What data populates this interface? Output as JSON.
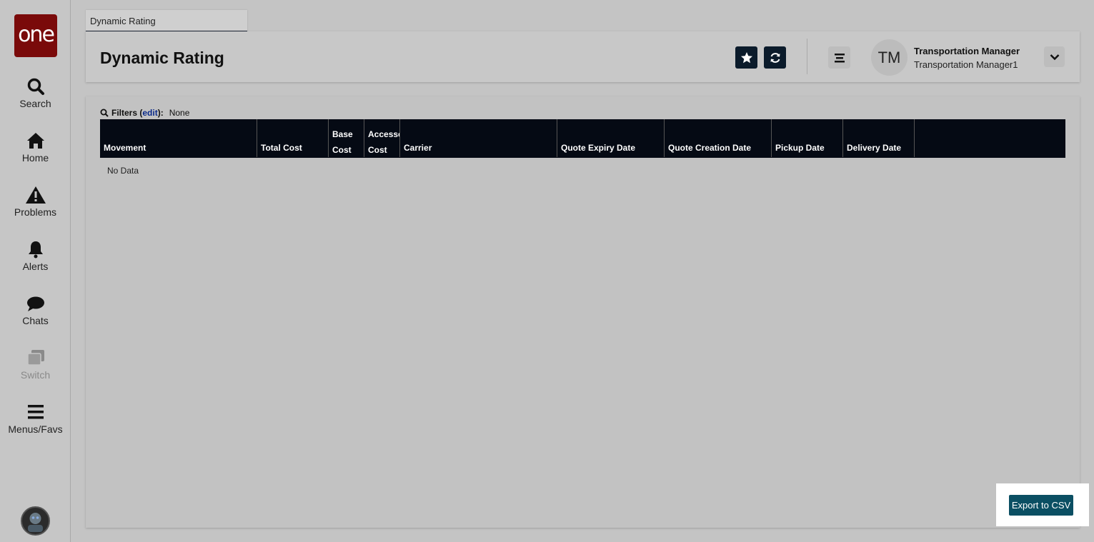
{
  "app": {
    "logo_text": "one",
    "tab_title": "Dynamic Rating"
  },
  "sidebar": {
    "items": [
      {
        "label": "Search",
        "icon": "search-icon"
      },
      {
        "label": "Home",
        "icon": "home-icon"
      },
      {
        "label": "Problems",
        "icon": "warning-icon"
      },
      {
        "label": "Alerts",
        "icon": "bell-icon"
      },
      {
        "label": "Chats",
        "icon": "chat-icon"
      },
      {
        "label": "Switch",
        "icon": "switch-icon"
      },
      {
        "label": "Menus/Favs",
        "icon": "menu-icon"
      }
    ]
  },
  "header": {
    "title": "Dynamic Rating",
    "user_initials": "TM",
    "user_name": "Transportation Manager",
    "user_role": "Transportation Manager1"
  },
  "filters": {
    "label": "Filters",
    "edit": "edit",
    "value": "None"
  },
  "table": {
    "columns": [
      "Movement",
      "Total Cost",
      "Base Cost",
      "Accessorial Cost",
      "Carrier",
      "Quote Expiry Date",
      "Quote Creation Date",
      "Pickup Date",
      "Delivery Date"
    ],
    "col_base_1": "Base",
    "col_base_2": "Cost",
    "col_acc_1": "Accesso",
    "col_acc_2": "Cost",
    "empty_text": "No Data"
  },
  "actions": {
    "export_label": "Export to CSV"
  },
  "colors": {
    "accent": "#0b4f63",
    "header_bg": "#050a14",
    "logo_bg": "#7a0a0a"
  }
}
